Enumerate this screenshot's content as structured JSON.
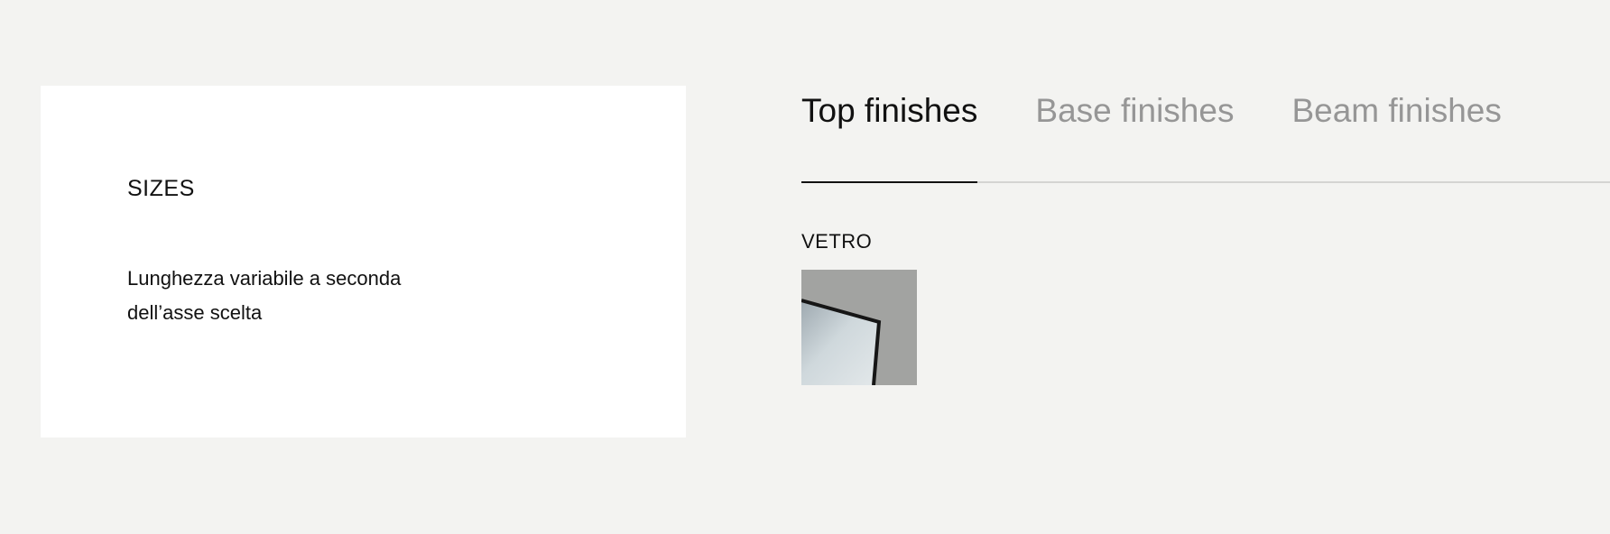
{
  "sizes": {
    "title": "SIZES",
    "description": "Lunghezza variabile a seconda dell’asse scelta"
  },
  "finishes": {
    "tabs": [
      {
        "label": "Top finishes",
        "active": true
      },
      {
        "label": "Base finishes",
        "active": false
      },
      {
        "label": "Beam finishes",
        "active": false
      }
    ],
    "groups": [
      {
        "title": "VETRO",
        "swatches": [
          {
            "name": "vetro-glass-swatch"
          }
        ]
      }
    ]
  },
  "colors": {
    "page_background": "#f3f3f1",
    "card_background": "#ffffff",
    "text": "#111111",
    "inactive_tab": "#969696",
    "tab_rule": "#d4d4d2"
  }
}
